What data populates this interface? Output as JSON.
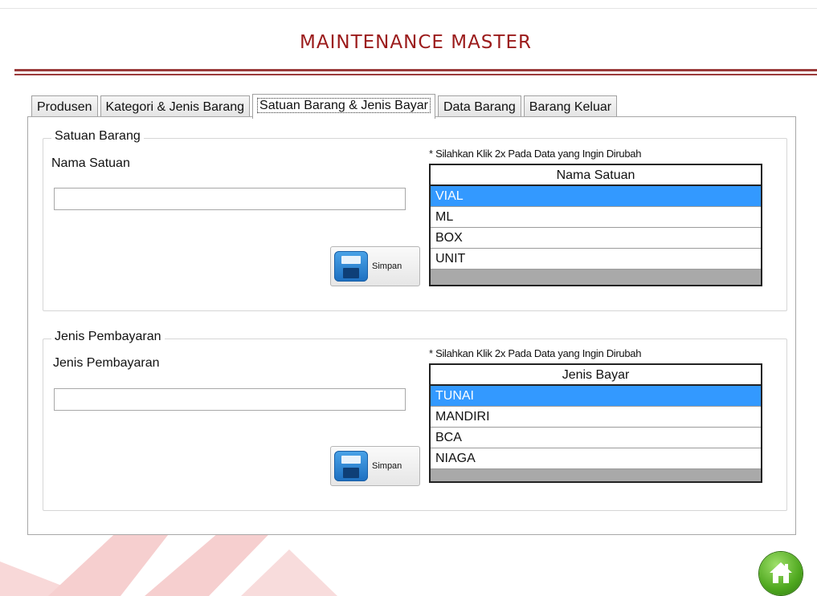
{
  "app_title": "MAINTENANCE MASTER",
  "tabs": [
    {
      "label": "Produsen"
    },
    {
      "label": "Kategori & Jenis Barang"
    },
    {
      "label": "Satuan Barang & Jenis Bayar"
    },
    {
      "label": "Data Barang"
    },
    {
      "label": "Barang Keluar"
    }
  ],
  "active_tab": "Satuan Barang & Jenis Bayar",
  "satuan": {
    "group_title": "Satuan Barang",
    "field_label": "Nama Satuan",
    "input_value": "",
    "save_label": "Simpan",
    "note": "* Silahkan Klik 2x Pada Data yang Ingin Dirubah",
    "grid_header": "Nama Satuan",
    "rows": [
      "VIAL",
      "ML",
      "BOX",
      "UNIT"
    ],
    "selected_row": "VIAL"
  },
  "bayar": {
    "group_title": "Jenis Pembayaran",
    "field_label": "Jenis Pembayaran",
    "input_value": "",
    "save_label": "Simpan",
    "note": "* Silahkan Klik 2x Pada Data yang Ingin Dirubah",
    "grid_header": "Jenis Bayar",
    "rows": [
      "TUNAI",
      "MANDIRI",
      "BCA",
      "NIAGA"
    ],
    "selected_row": "TUNAI"
  },
  "icons": {
    "save": "floppy-disk-icon",
    "home": "home-icon"
  },
  "colors": {
    "title": "#9b1b1b",
    "rule": "#9b3a3a",
    "selection": "#3399ff",
    "home": "#4fa81f"
  }
}
